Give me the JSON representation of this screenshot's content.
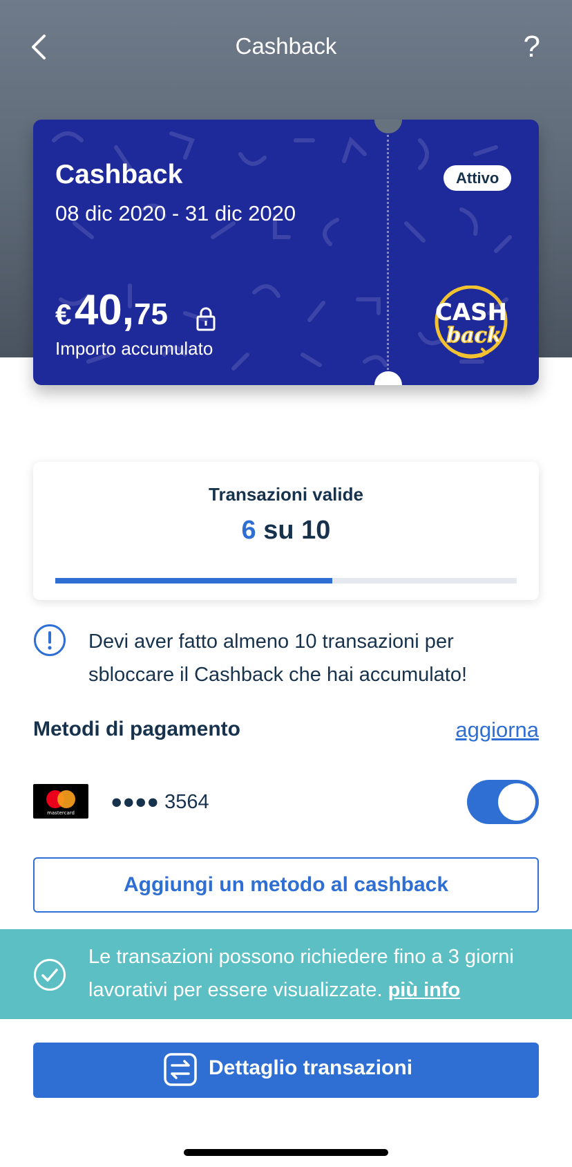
{
  "header": {
    "title": "Cashback",
    "help_label": "?"
  },
  "card": {
    "title": "Cashback",
    "period": "08 dic 2020 - 31 dic 2020",
    "status": "Attivo",
    "amount_currency": "€",
    "amount_integer": "40,",
    "amount_decimal": "75",
    "amount_label": "Importo accumulato",
    "logo_text_top": "CASH",
    "logo_text_bottom": "back",
    "bg_color": "#1f2a9a",
    "logo_color": "#f2c230"
  },
  "transactions": {
    "title": "Transazioni valide",
    "done": "6",
    "separator": "su",
    "total": "10",
    "progress_fraction": 0.6
  },
  "notice": {
    "icon": "exclamation-circle-icon",
    "text": "Devi aver fatto almeno 10 transazioni per sbloccare il Cashback che hai accumulato!"
  },
  "payment_methods": {
    "heading": "Metodi di pagamento",
    "update_label": "aggiorna",
    "items": [
      {
        "brand": "mastercard",
        "brand_label": "mastercard",
        "masked_number": "●●●● 3564",
        "enabled": true
      }
    ],
    "add_label": "Aggiungi un metodo al cashback"
  },
  "info_banner": {
    "icon": "check-circle-icon",
    "text": "Le transazioni possono richiedere fino a 3 giorni lavorativi per essere visualizzate.",
    "link_label": "più info",
    "bg_color": "#5bbfc3"
  },
  "detail_button": {
    "icon": "transfer-arrows-icon",
    "label": "Dettaglio transazioni"
  },
  "colors": {
    "accent": "#2f6fd3",
    "text": "#17324d"
  }
}
